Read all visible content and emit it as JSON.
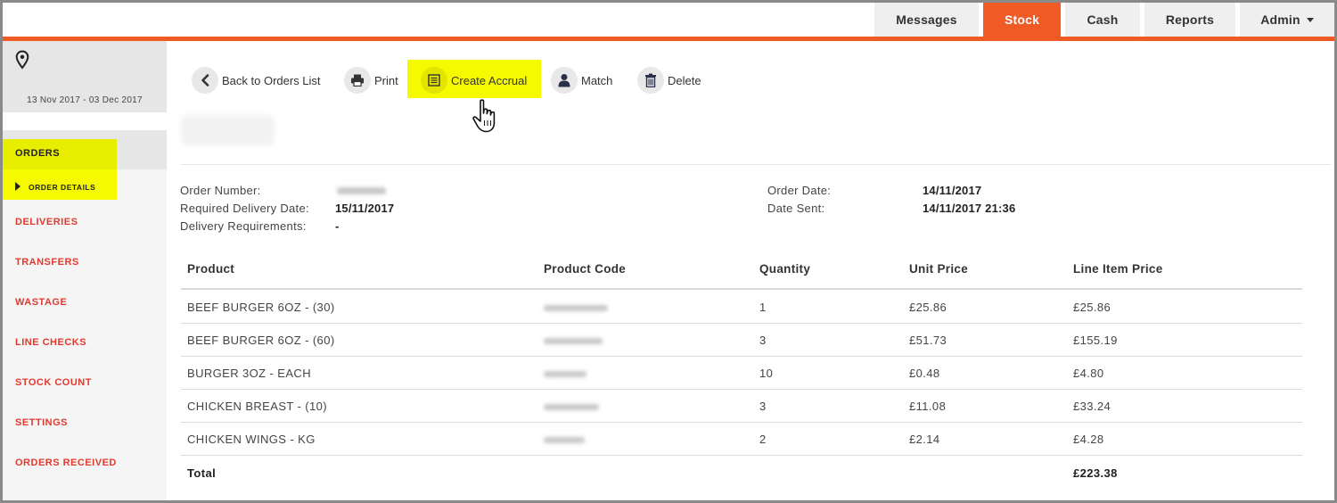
{
  "nav": {
    "tabs": [
      {
        "label": "Messages",
        "active": false
      },
      {
        "label": "Stock",
        "active": true
      },
      {
        "label": "Cash",
        "active": false
      },
      {
        "label": "Reports",
        "active": false
      },
      {
        "label": "Admin",
        "active": false,
        "has_dropdown": true
      }
    ],
    "accent_color": "#f05a24"
  },
  "sidebar": {
    "date_range": "13 Nov 2017 - 03 Dec 2017",
    "location_icon": "map-pin-icon",
    "items": [
      {
        "label": "ORDERS",
        "highlighted": true
      },
      {
        "label": "ORDER DETAILS",
        "sub": true,
        "highlighted": true
      },
      {
        "label": "DELIVERIES"
      },
      {
        "label": "TRANSFERS"
      },
      {
        "label": "WASTAGE"
      },
      {
        "label": "LINE CHECKS"
      },
      {
        "label": "STOCK COUNT"
      },
      {
        "label": "SETTINGS"
      },
      {
        "label": "ORDERS RECEIVED"
      }
    ],
    "item_color": "#e03a2f",
    "highlight_color": "#f6fa00"
  },
  "toolbar": {
    "back_label": "Back to Orders List",
    "print_label": "Print",
    "accrual_label": "Create Accrual",
    "match_label": "Match",
    "delete_label": "Delete"
  },
  "order": {
    "order_number_label": "Order Number:",
    "required_delivery_label": "Required Delivery Date:",
    "required_delivery_value": "15/11/2017",
    "delivery_requirements_label": "Delivery Requirements:",
    "delivery_requirements_value": "-",
    "order_date_label": "Order Date:",
    "order_date_value": "14/11/2017",
    "date_sent_label": "Date Sent:",
    "date_sent_value": "14/11/2017 21:36"
  },
  "table": {
    "headers": [
      "Product",
      "Product Code",
      "Quantity",
      "Unit Price",
      "Line Item Price"
    ],
    "rows": [
      {
        "product": "BEEF BURGER 6OZ - (30)",
        "quantity": "1",
        "unit_price": "£25.86",
        "line_price": "£25.86"
      },
      {
        "product": "BEEF BURGER 6OZ - (60)",
        "quantity": "3",
        "unit_price": "£51.73",
        "line_price": "£155.19"
      },
      {
        "product": "BURGER 3OZ - EACH",
        "quantity": "10",
        "unit_price": "£0.48",
        "line_price": "£4.80"
      },
      {
        "product": "CHICKEN BREAST - (10)",
        "quantity": "3",
        "unit_price": "£11.08",
        "line_price": "£33.24"
      },
      {
        "product": "CHICKEN WINGS - KG",
        "quantity": "2",
        "unit_price": "£2.14",
        "line_price": "£4.28"
      }
    ],
    "total_label": "Total",
    "total_value": "£223.38"
  }
}
